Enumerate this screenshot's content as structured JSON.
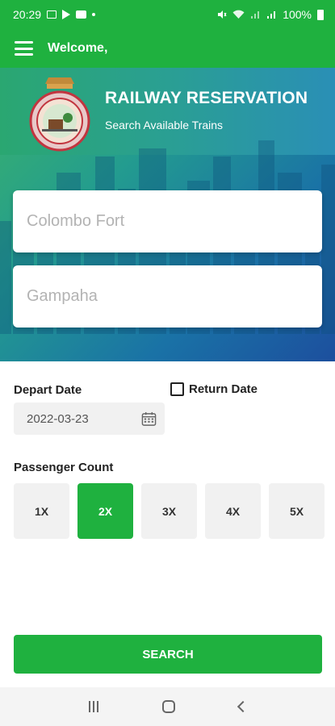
{
  "status_bar": {
    "time": "20:29",
    "battery": "100%",
    "icons_left": [
      "image-icon",
      "play-icon",
      "message-icon",
      "dot-icon"
    ],
    "icons_right": [
      "mute-icon",
      "wifi-icon",
      "signal-icon",
      "signal-icon",
      "battery-icon"
    ]
  },
  "app_bar": {
    "welcome": "Welcome,"
  },
  "hero": {
    "title": "RAILWAY RESERVATION",
    "subtitle": "Search Available Trains"
  },
  "from_station": {
    "placeholder": "Colombo Fort"
  },
  "to_station": {
    "placeholder": "Gampaha"
  },
  "depart": {
    "label": "Depart Date",
    "value": "2022-03-23"
  },
  "return": {
    "label": "Return Date",
    "checked": false
  },
  "passenger": {
    "label": "Passenger Count",
    "options": [
      "1X",
      "2X",
      "3X",
      "4X",
      "5X"
    ],
    "selected": "2X"
  },
  "search": {
    "label": "SEARCH"
  },
  "colors": {
    "primary": "#1fb13f",
    "hero_start": "#3bb36a",
    "hero_end": "#1c4f9e"
  }
}
